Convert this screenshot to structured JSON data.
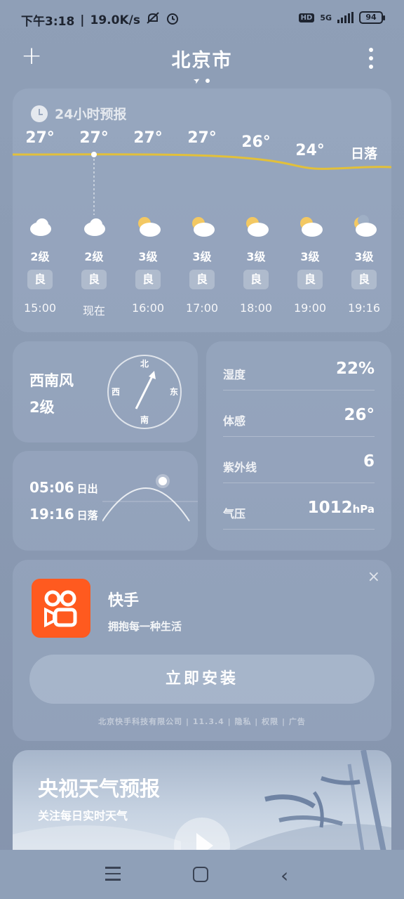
{
  "status_bar": {
    "time": "下午3:18",
    "speed": "19.0K/s",
    "network": "5G",
    "hd": "HD",
    "battery": "94"
  },
  "header": {
    "city": "北京市"
  },
  "hourly": {
    "title": "24小时预报",
    "temps": [
      "27°",
      "27°",
      "27°",
      "27°",
      "26°",
      "24°",
      "日落"
    ],
    "items": [
      {
        "wind": "2级",
        "aqi": "良",
        "time": "15:00",
        "icon": "cloudy-icon"
      },
      {
        "wind": "2级",
        "aqi": "良",
        "time": "现在",
        "icon": "cloudy-icon"
      },
      {
        "wind": "3级",
        "aqi": "良",
        "time": "16:00",
        "icon": "partly-cloudy-icon"
      },
      {
        "wind": "3级",
        "aqi": "良",
        "time": "17:00",
        "icon": "partly-cloudy-icon"
      },
      {
        "wind": "3级",
        "aqi": "良",
        "time": "18:00",
        "icon": "partly-cloudy-icon"
      },
      {
        "wind": "3级",
        "aqi": "良",
        "time": "19:00",
        "icon": "partly-cloudy-icon"
      },
      {
        "wind": "3级",
        "aqi": "良",
        "time": "19:16",
        "icon": "moon-cloudy-icon"
      }
    ]
  },
  "wind": {
    "direction": "西南风",
    "level": "2级",
    "compass": {
      "n": "北",
      "s": "南",
      "e": "东",
      "w": "西"
    }
  },
  "sun": {
    "sunrise_time": "05:06",
    "sunrise_label": "日出",
    "sunset_time": "19:16",
    "sunset_label": "日落"
  },
  "details": [
    {
      "label": "湿度",
      "value": "22%",
      "unit": ""
    },
    {
      "label": "体感",
      "value": "26°",
      "unit": ""
    },
    {
      "label": "紫外线",
      "value": "6",
      "unit": ""
    },
    {
      "label": "气压",
      "value": "1012",
      "unit": "hPa"
    }
  ],
  "ad": {
    "app_name": "快手",
    "description": "拥抱每一种生活",
    "install_label": "立即安装",
    "footer": "北京快手科技有限公司 | 11.3.4 | 隐私 | 权限 | 广告",
    "close": "×"
  },
  "video": {
    "title": "央视天气预报",
    "subtitle": "关注每日实时天气"
  }
}
